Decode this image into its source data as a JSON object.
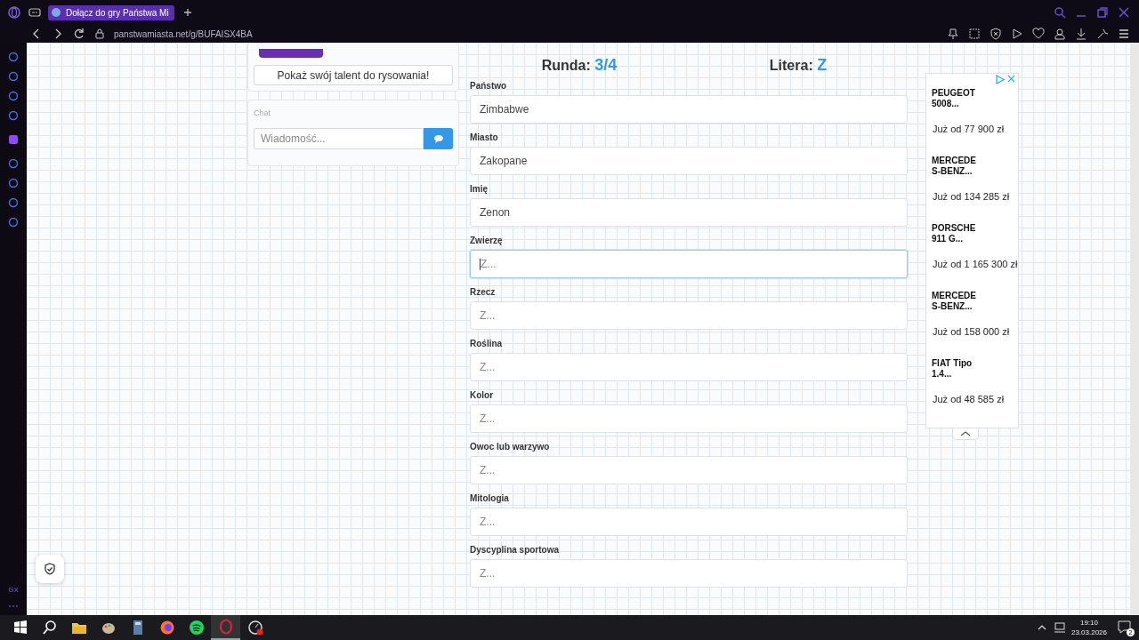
{
  "browser": {
    "tab_title": "Dołącz do gry Państwa Mi",
    "address": "panstwamiasta.net/g/BUFAISX4BA"
  },
  "left_panel": {
    "draw_button": "Pokaż swój talent do rysowania!",
    "chat_title": "Chat",
    "chat_placeholder": "Wiadomość..."
  },
  "header": {
    "round_label": "Runda:",
    "round_value": "3/4",
    "letter_label": "Litera:",
    "letter_value": "Z"
  },
  "fields": [
    {
      "label": "Państwo",
      "value": "Zimbabwe",
      "focused": false
    },
    {
      "label": "Miasto",
      "value": "Zakopane",
      "focused": false
    },
    {
      "label": "Imię",
      "value": "Zenon",
      "focused": false
    },
    {
      "label": "Zwierzę",
      "placeholder": "Z...",
      "focused": true
    },
    {
      "label": "Rzecz",
      "placeholder": "Z...",
      "focused": false
    },
    {
      "label": "Roślina",
      "placeholder": "Z...",
      "focused": false
    },
    {
      "label": "Kolor",
      "placeholder": "Z...",
      "focused": false
    },
    {
      "label": "Owoc lub warzywo",
      "placeholder": "Z...",
      "focused": false
    },
    {
      "label": "Mitologia",
      "placeholder": "Z...",
      "focused": false
    },
    {
      "label": "Dyscyplina sportowa",
      "placeholder": "Z...",
      "focused": false
    }
  ],
  "ad": {
    "items": [
      {
        "title": "PEUGEOT 5008...",
        "price": "Już od 77 900 zł"
      },
      {
        "title": "MERCEDE S-BENZ...",
        "price": "Już od 134 285 zł"
      },
      {
        "title": "PORSCHE 911 G...",
        "price": "Już od 1 165 300 zł"
      },
      {
        "title": "MERCEDE S-BENZ...",
        "price": "Już od 158 000 zł"
      },
      {
        "title": "FIAT Tipo 1.4...",
        "price": "Już od 48 585 zł"
      }
    ]
  },
  "sidebar": {
    "badge": "GX"
  },
  "taskbar": {
    "time": "19:10",
    "date": "23.03.2026",
    "notifications": "2"
  }
}
